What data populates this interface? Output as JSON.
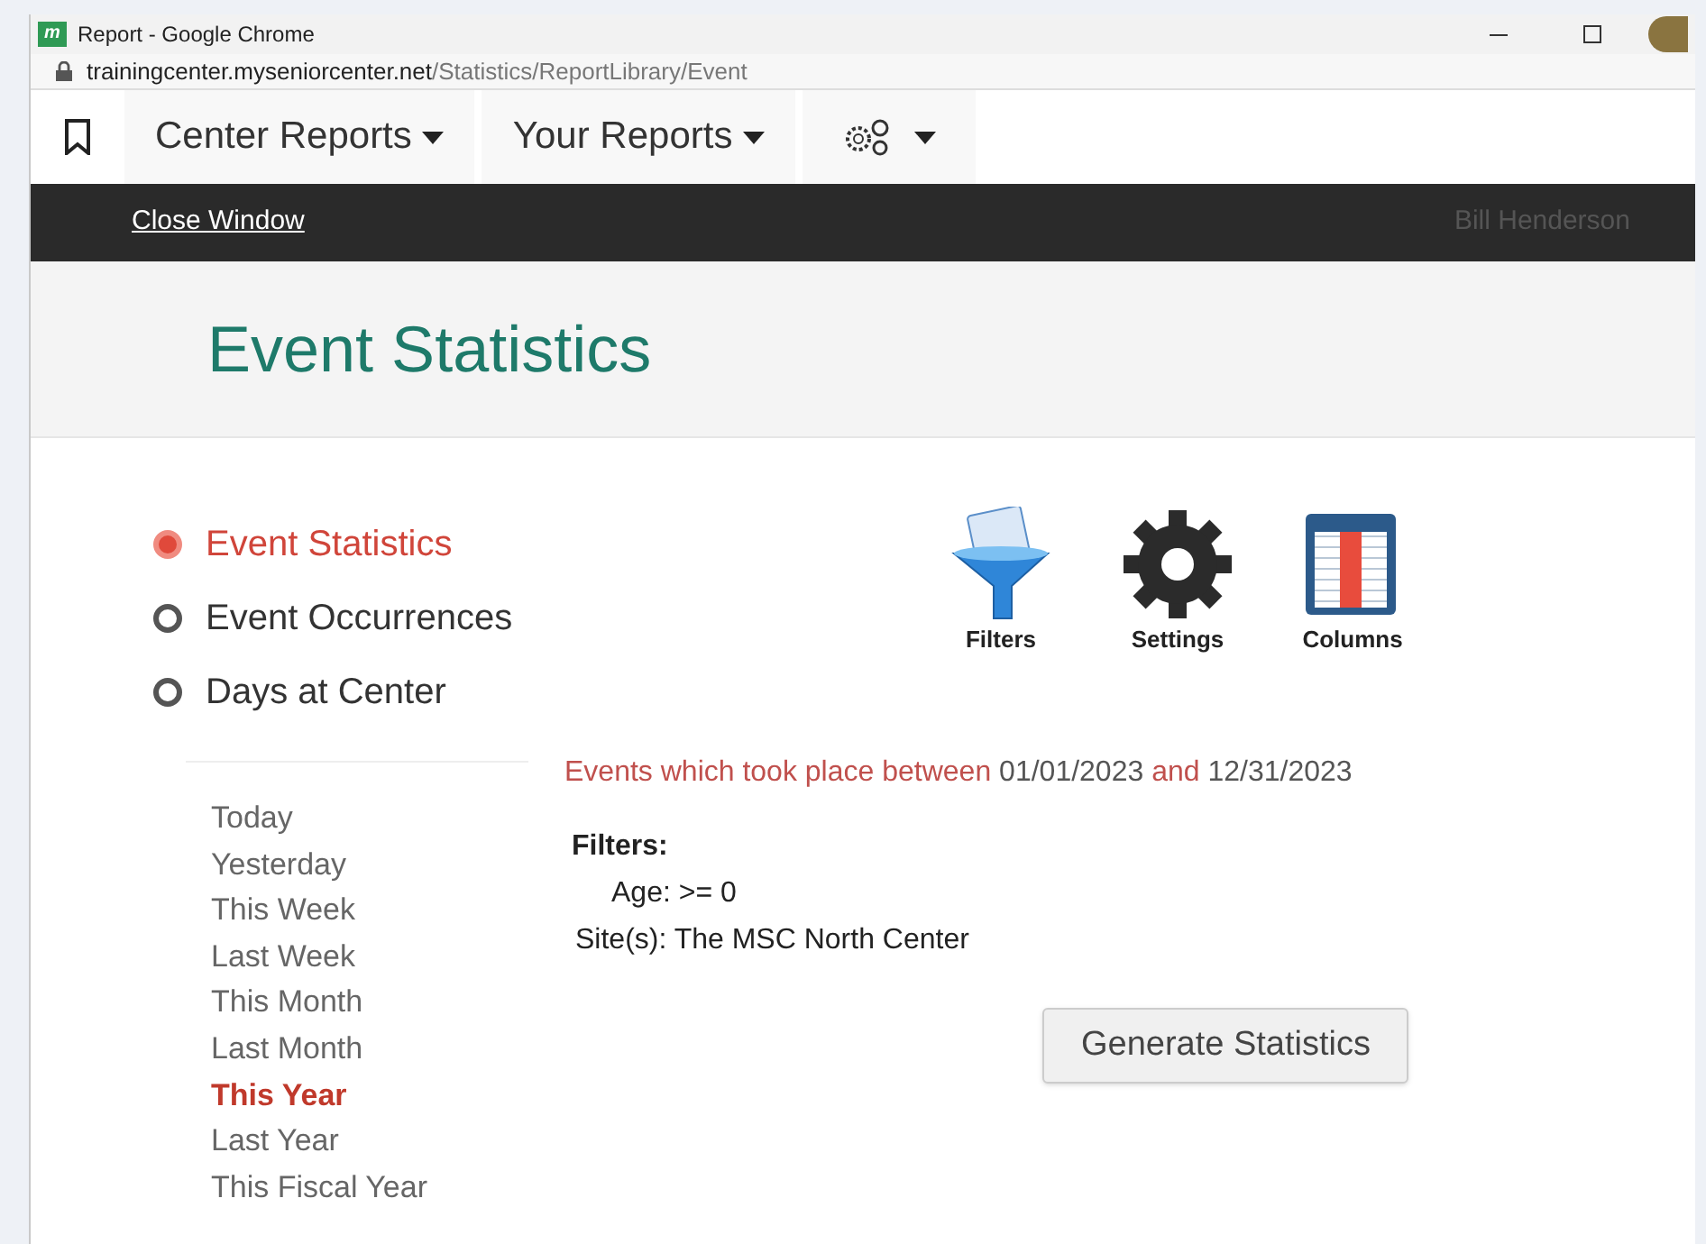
{
  "window": {
    "title": "Report - Google Chrome",
    "app_icon": "m"
  },
  "url": {
    "host": "trainingcenter.myseniorcenter.net",
    "path": "/Statistics/ReportLibrary/Event"
  },
  "nav": [
    {
      "kind": "bookmark"
    },
    {
      "kind": "menu",
      "label": "Center Reports"
    },
    {
      "kind": "menu",
      "label": "Your Reports"
    },
    {
      "kind": "gears"
    }
  ],
  "topbar": {
    "link": "Close Window",
    "user": "Bill Henderson"
  },
  "page_title": "Event Statistics",
  "reports": [
    {
      "label": "Event Statistics",
      "selected": true
    },
    {
      "label": "Event Occurrences",
      "selected": false
    },
    {
      "label": "Days at Center",
      "selected": false
    }
  ],
  "tools": [
    {
      "kind": "filters",
      "label": "Filters"
    },
    {
      "kind": "settings",
      "label": "Settings"
    },
    {
      "kind": "columns",
      "label": "Columns"
    }
  ],
  "ranges": [
    {
      "label": "Today",
      "selected": false
    },
    {
      "label": "Yesterday",
      "selected": false
    },
    {
      "label": "This Week",
      "selected": false
    },
    {
      "label": "Last Week",
      "selected": false
    },
    {
      "label": "This Month",
      "selected": false
    },
    {
      "label": "Last Month",
      "selected": false
    },
    {
      "label": "This Year",
      "selected": true
    },
    {
      "label": "Last Year",
      "selected": false
    },
    {
      "label": "This Fiscal Year",
      "selected": false
    }
  ],
  "summary": {
    "intro": "Events which took place between",
    "start": "01/01/2023",
    "joiner": "and",
    "end": "12/31/2023"
  },
  "filters": {
    "heading": "Filters:",
    "lines": [
      "Age: >= 0",
      "Site(s): The MSC North Center"
    ]
  },
  "button": "Generate Statistics"
}
